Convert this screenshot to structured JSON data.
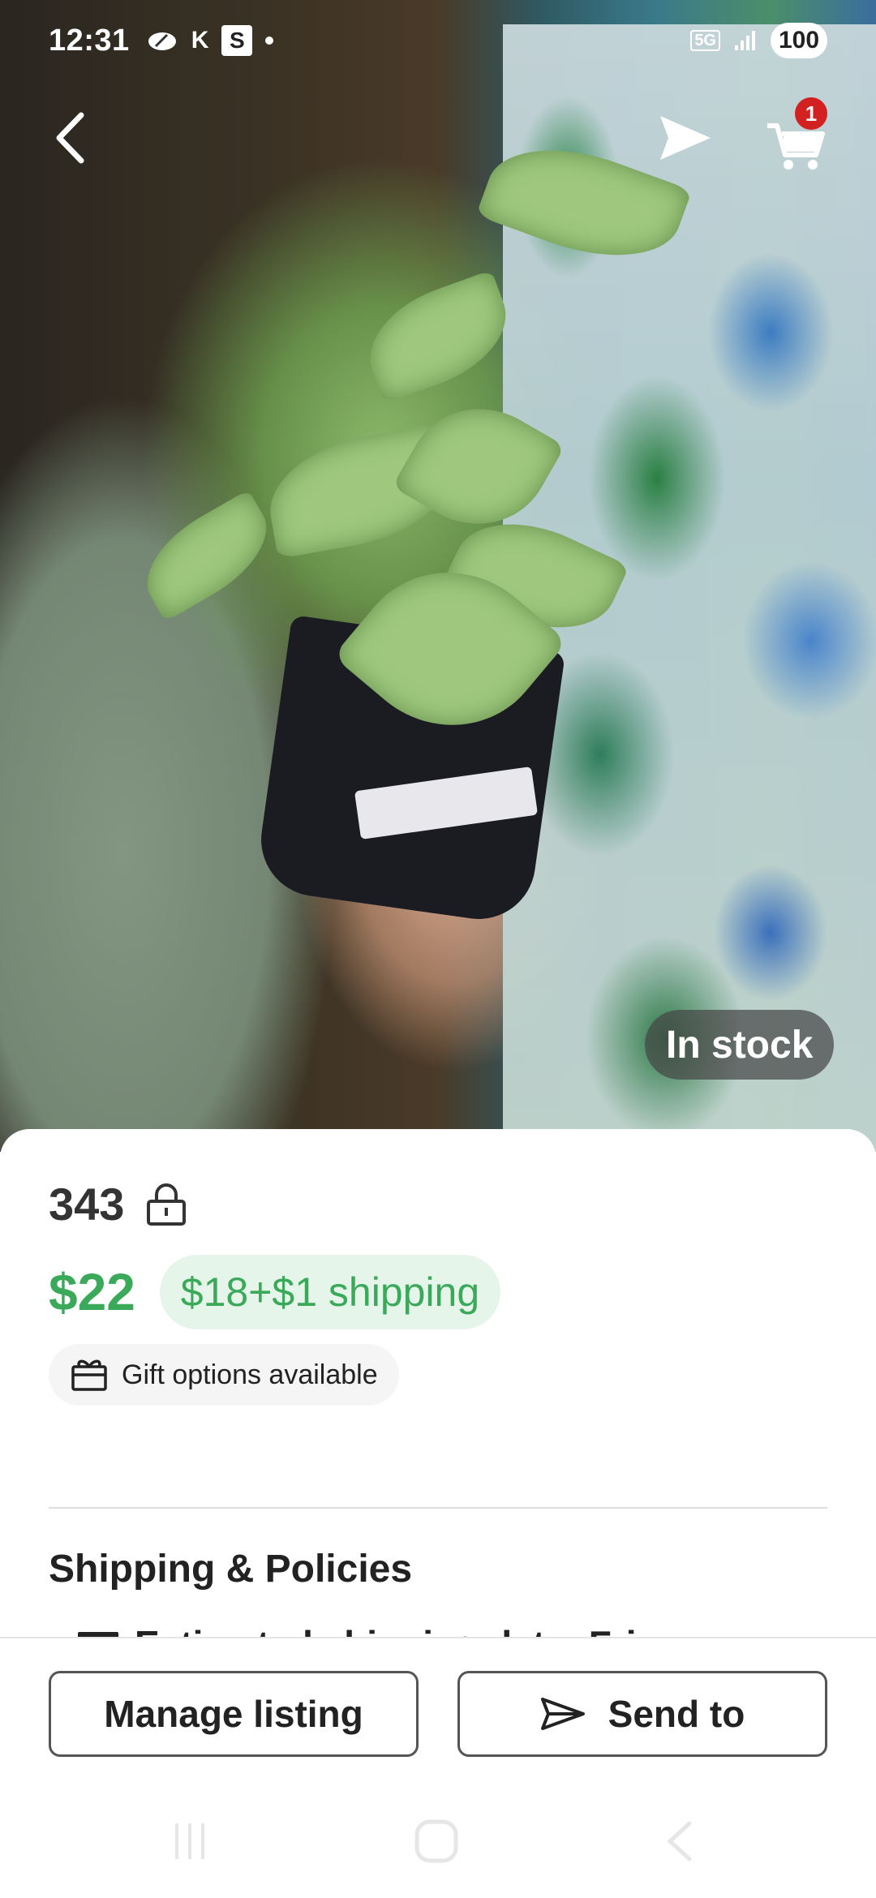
{
  "status_bar": {
    "time": "12:31",
    "k_label": "K",
    "s_label": "S",
    "network": "5G",
    "battery": "100"
  },
  "nav": {
    "cart_count": "1"
  },
  "hero": {
    "stock_label": "In stock"
  },
  "listing": {
    "quantity": "343",
    "price": "$22",
    "sale_price": "$18+$1 shipping",
    "gift_label": "Gift options available",
    "section_title": "Shipping & Policies",
    "peek_text": "Estimated shipping date: Fri"
  },
  "actions": {
    "manage_label": "Manage listing",
    "send_label": "Send to"
  },
  "colors": {
    "price_green": "#3ba95a",
    "pill_bg": "#e6f5ea",
    "badge_red": "#d32020"
  },
  "icons": [
    "back-arrow-icon",
    "share-icon",
    "cart-icon",
    "lock-icon",
    "gift-icon",
    "send-icon",
    "recents-icon",
    "home-icon",
    "nav-back-icon"
  ]
}
